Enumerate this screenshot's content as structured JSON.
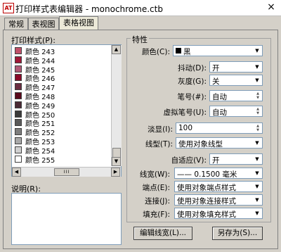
{
  "window": {
    "title": "打印样式表编辑器 - monochrome.ctb",
    "close_glyph": "×",
    "app_icon_text": "AT"
  },
  "tabs": [
    {
      "label": "常规",
      "active": false
    },
    {
      "label": "表视图",
      "active": false
    },
    {
      "label": "表格视图",
      "active": true
    }
  ],
  "print_styles": {
    "label": "打印样式(P):",
    "items": [
      {
        "label": "颜色 243",
        "color": "#c0506a"
      },
      {
        "label": "颜色 244",
        "color": "#a01838"
      },
      {
        "label": "颜色 245",
        "color": "#b05a78"
      },
      {
        "label": "颜色 246",
        "color": "#8a0a2a"
      },
      {
        "label": "颜色 247",
        "color": "#6a2d42"
      },
      {
        "label": "颜色 248",
        "color": "#5a0a1e"
      },
      {
        "label": "颜色 249",
        "color": "#4a2a35"
      },
      {
        "label": "颜色 250",
        "color": "#3a3a3a"
      },
      {
        "label": "颜色 251",
        "color": "#5a5a5a"
      },
      {
        "label": "颜色 252",
        "color": "#7e7e7e"
      },
      {
        "label": "颜色 253",
        "color": "#a8a8a8"
      },
      {
        "label": "颜色 254",
        "color": "#d0d0d0"
      },
      {
        "label": "颜色 255",
        "color": "#ffffff"
      }
    ]
  },
  "description": {
    "label": "说明(R):"
  },
  "properties": {
    "legend": "特性",
    "color": {
      "label": "颜色(C):",
      "value": "黑",
      "swatch": "#000000"
    },
    "dither": {
      "label": "抖动(D):",
      "value": "开"
    },
    "grayscale": {
      "label": "灰度(G):",
      "value": "关"
    },
    "pen": {
      "label": "笔号(#):",
      "value": "自动"
    },
    "virtual_pen": {
      "label": "虚拟笔号(U):",
      "value": "自动"
    },
    "screening": {
      "label": "淡显(I):",
      "value": "100"
    },
    "linetype": {
      "label": "线型(T):",
      "value": "使用对象线型"
    },
    "adaptive": {
      "label": "自适应(V):",
      "value": "开"
    },
    "lineweight": {
      "label": "线宽(W):",
      "value": "—— 0.1500 毫米"
    },
    "line_end": {
      "label": "端点(E):",
      "value": "使用对象端点样式"
    },
    "line_join": {
      "label": "连接(J):",
      "value": "使用对象连接样式"
    },
    "fill": {
      "label": "填充(F):",
      "value": "使用对象填充样式"
    }
  },
  "buttons": {
    "edit_lineweights": "编辑线宽(L)...",
    "save_as": "另存为(S)..."
  },
  "scroll": {
    "up": "▲",
    "down": "▼",
    "left": "◀",
    "right": "▶",
    "grip": "III",
    "dropdown": "▼",
    "spin_up": "▲",
    "spin_down": "▼"
  }
}
